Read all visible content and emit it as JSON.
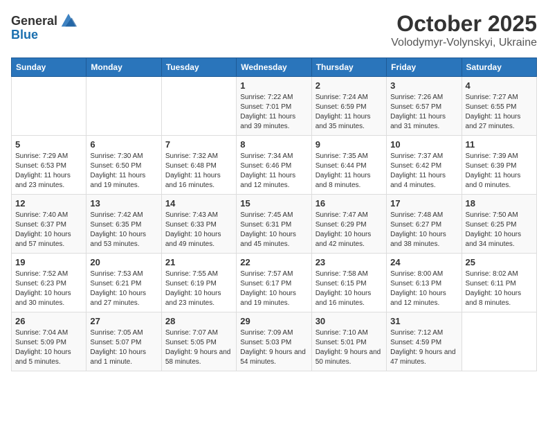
{
  "logo": {
    "general": "General",
    "blue": "Blue"
  },
  "header": {
    "month": "October 2025",
    "location": "Volodymyr-Volynskyi, Ukraine"
  },
  "weekdays": [
    "Sunday",
    "Monday",
    "Tuesday",
    "Wednesday",
    "Thursday",
    "Friday",
    "Saturday"
  ],
  "weeks": [
    [
      {
        "day": "",
        "info": ""
      },
      {
        "day": "",
        "info": ""
      },
      {
        "day": "",
        "info": ""
      },
      {
        "day": "1",
        "info": "Sunrise: 7:22 AM\nSunset: 7:01 PM\nDaylight: 11 hours and 39 minutes."
      },
      {
        "day": "2",
        "info": "Sunrise: 7:24 AM\nSunset: 6:59 PM\nDaylight: 11 hours and 35 minutes."
      },
      {
        "day": "3",
        "info": "Sunrise: 7:26 AM\nSunset: 6:57 PM\nDaylight: 11 hours and 31 minutes."
      },
      {
        "day": "4",
        "info": "Sunrise: 7:27 AM\nSunset: 6:55 PM\nDaylight: 11 hours and 27 minutes."
      }
    ],
    [
      {
        "day": "5",
        "info": "Sunrise: 7:29 AM\nSunset: 6:53 PM\nDaylight: 11 hours and 23 minutes."
      },
      {
        "day": "6",
        "info": "Sunrise: 7:30 AM\nSunset: 6:50 PM\nDaylight: 11 hours and 19 minutes."
      },
      {
        "day": "7",
        "info": "Sunrise: 7:32 AM\nSunset: 6:48 PM\nDaylight: 11 hours and 16 minutes."
      },
      {
        "day": "8",
        "info": "Sunrise: 7:34 AM\nSunset: 6:46 PM\nDaylight: 11 hours and 12 minutes."
      },
      {
        "day": "9",
        "info": "Sunrise: 7:35 AM\nSunset: 6:44 PM\nDaylight: 11 hours and 8 minutes."
      },
      {
        "day": "10",
        "info": "Sunrise: 7:37 AM\nSunset: 6:42 PM\nDaylight: 11 hours and 4 minutes."
      },
      {
        "day": "11",
        "info": "Sunrise: 7:39 AM\nSunset: 6:39 PM\nDaylight: 11 hours and 0 minutes."
      }
    ],
    [
      {
        "day": "12",
        "info": "Sunrise: 7:40 AM\nSunset: 6:37 PM\nDaylight: 10 hours and 57 minutes."
      },
      {
        "day": "13",
        "info": "Sunrise: 7:42 AM\nSunset: 6:35 PM\nDaylight: 10 hours and 53 minutes."
      },
      {
        "day": "14",
        "info": "Sunrise: 7:43 AM\nSunset: 6:33 PM\nDaylight: 10 hours and 49 minutes."
      },
      {
        "day": "15",
        "info": "Sunrise: 7:45 AM\nSunset: 6:31 PM\nDaylight: 10 hours and 45 minutes."
      },
      {
        "day": "16",
        "info": "Sunrise: 7:47 AM\nSunset: 6:29 PM\nDaylight: 10 hours and 42 minutes."
      },
      {
        "day": "17",
        "info": "Sunrise: 7:48 AM\nSunset: 6:27 PM\nDaylight: 10 hours and 38 minutes."
      },
      {
        "day": "18",
        "info": "Sunrise: 7:50 AM\nSunset: 6:25 PM\nDaylight: 10 hours and 34 minutes."
      }
    ],
    [
      {
        "day": "19",
        "info": "Sunrise: 7:52 AM\nSunset: 6:23 PM\nDaylight: 10 hours and 30 minutes."
      },
      {
        "day": "20",
        "info": "Sunrise: 7:53 AM\nSunset: 6:21 PM\nDaylight: 10 hours and 27 minutes."
      },
      {
        "day": "21",
        "info": "Sunrise: 7:55 AM\nSunset: 6:19 PM\nDaylight: 10 hours and 23 minutes."
      },
      {
        "day": "22",
        "info": "Sunrise: 7:57 AM\nSunset: 6:17 PM\nDaylight: 10 hours and 19 minutes."
      },
      {
        "day": "23",
        "info": "Sunrise: 7:58 AM\nSunset: 6:15 PM\nDaylight: 10 hours and 16 minutes."
      },
      {
        "day": "24",
        "info": "Sunrise: 8:00 AM\nSunset: 6:13 PM\nDaylight: 10 hours and 12 minutes."
      },
      {
        "day": "25",
        "info": "Sunrise: 8:02 AM\nSunset: 6:11 PM\nDaylight: 10 hours and 8 minutes."
      }
    ],
    [
      {
        "day": "26",
        "info": "Sunrise: 7:04 AM\nSunset: 5:09 PM\nDaylight: 10 hours and 5 minutes."
      },
      {
        "day": "27",
        "info": "Sunrise: 7:05 AM\nSunset: 5:07 PM\nDaylight: 10 hours and 1 minute."
      },
      {
        "day": "28",
        "info": "Sunrise: 7:07 AM\nSunset: 5:05 PM\nDaylight: 9 hours and 58 minutes."
      },
      {
        "day": "29",
        "info": "Sunrise: 7:09 AM\nSunset: 5:03 PM\nDaylight: 9 hours and 54 minutes."
      },
      {
        "day": "30",
        "info": "Sunrise: 7:10 AM\nSunset: 5:01 PM\nDaylight: 9 hours and 50 minutes."
      },
      {
        "day": "31",
        "info": "Sunrise: 7:12 AM\nSunset: 4:59 PM\nDaylight: 9 hours and 47 minutes."
      },
      {
        "day": "",
        "info": ""
      }
    ]
  ]
}
